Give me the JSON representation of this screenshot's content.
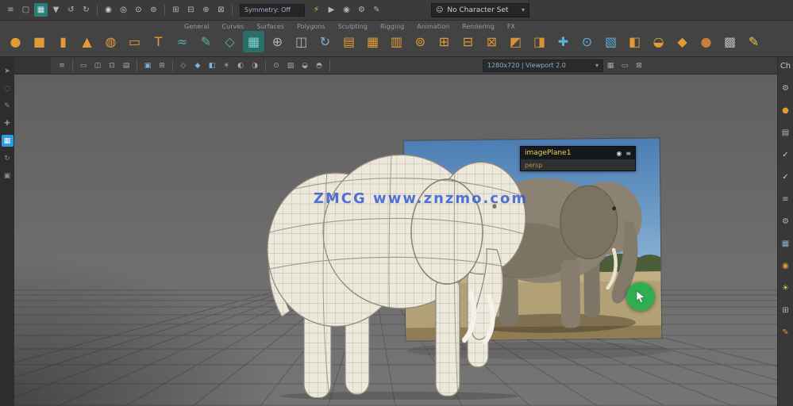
{
  "ui": {
    "caret": "▾"
  },
  "topbar": {
    "icons_left": [
      {
        "name": "menu-icon",
        "glyph": "≡",
        "color": "#b5b5b5"
      },
      {
        "name": "new-scene-icon",
        "glyph": "▢",
        "color": "#b5b5b5"
      },
      {
        "name": "open-scene-icon",
        "glyph": "▦",
        "color": "#cdeeea",
        "bg": "#2c7d78"
      },
      {
        "name": "save-scene-icon",
        "glyph": "▼",
        "color": "#b5b5b5"
      },
      {
        "name": "undo-icon",
        "glyph": "↺",
        "color": "#b5b5b5"
      },
      {
        "name": "redo-icon",
        "glyph": "↻",
        "color": "#b5b5b5"
      },
      {
        "sep": true,
        "name": "separator"
      },
      {
        "name": "select-hierarchy-icon",
        "glyph": "◉",
        "color": "#d0d0d0"
      },
      {
        "name": "select-object-icon",
        "glyph": "◎",
        "color": "#d0d0d0"
      },
      {
        "name": "select-component-icon",
        "glyph": "⊙",
        "color": "#d0d0d0"
      },
      {
        "name": "select-mask-icon",
        "glyph": "⊚",
        "color": "#9fc3e0"
      },
      {
        "sep": true,
        "name": "separator"
      },
      {
        "name": "snap-grid-icon",
        "glyph": "⊞",
        "color": "#b5b5b5"
      },
      {
        "name": "snap-curve-icon",
        "glyph": "⊟",
        "color": "#b5b5b5"
      },
      {
        "name": "snap-point-icon",
        "glyph": "⊕",
        "color": "#b5b5b5"
      },
      {
        "name": "snap-plane-icon",
        "glyph": "⊠",
        "color": "#b5b5b5"
      },
      {
        "sep": true,
        "name": "separator"
      }
    ],
    "selection_field": "Symmetry: Off",
    "icons_mid": [
      {
        "name": "construction-history-icon",
        "glyph": "⚡",
        "color": "#d8c44a"
      },
      {
        "name": "render-icon",
        "glyph": "▶",
        "color": "#b5b5b5"
      },
      {
        "name": "ipr-render-icon",
        "glyph": "◉",
        "color": "#b5b5b5"
      },
      {
        "name": "render-settings-icon",
        "glyph": "⚙",
        "color": "#b5b5b5"
      },
      {
        "name": "paint-effects-icon",
        "glyph": "✎",
        "color": "#b5b5b5"
      }
    ],
    "workspace": {
      "icon_glyph": "☺",
      "label": "No Character Set"
    }
  },
  "shelf": {
    "tabs": [
      {
        "name": "shelf-tab-general",
        "label": "General"
      },
      {
        "name": "shelf-tab-curves",
        "label": "Curves"
      },
      {
        "name": "shelf-tab-surfaces",
        "label": "Surfaces"
      },
      {
        "name": "shelf-tab-polygons",
        "label": "Polygons"
      },
      {
        "name": "shelf-tab-sculpting",
        "label": "Sculpting"
      },
      {
        "name": "shelf-tab-rigging",
        "label": "Rigging"
      },
      {
        "name": "shelf-tab-animation",
        "label": "Animation"
      },
      {
        "name": "shelf-tab-rendering",
        "label": "Rendering"
      },
      {
        "name": "shelf-tab-fx",
        "label": "FX"
      }
    ],
    "icons": [
      {
        "name": "sphere-primitive-icon",
        "glyph": "●",
        "color": "#e09b36"
      },
      {
        "name": "cube-primitive-icon",
        "glyph": "■",
        "color": "#e09b36"
      },
      {
        "name": "cylinder-primitive-icon",
        "glyph": "▮",
        "color": "#e09b36"
      },
      {
        "name": "cone-primitive-icon",
        "glyph": "▲",
        "color": "#e09b36"
      },
      {
        "name": "torus-primitive-icon",
        "glyph": "◍",
        "color": "#e09b36"
      },
      {
        "name": "plane-primitive-icon",
        "glyph": "▭",
        "color": "#e09b36"
      },
      {
        "name": "text-tool-icon",
        "glyph": "T",
        "color": "#e09b36"
      },
      {
        "name": "curve-tool-icon",
        "glyph": "≈",
        "color": "#4fb3aa"
      },
      {
        "name": "pencil-curve-icon",
        "glyph": "✎",
        "color": "#4fb3aa"
      },
      {
        "name": "ep-curve-icon",
        "glyph": "◇",
        "color": "#4fb3aa"
      },
      {
        "name": "panel-window-icon",
        "glyph": "▦",
        "color": "#7fd0ca",
        "bg": "#2c6f6a"
      },
      {
        "name": "magnet-icon",
        "glyph": "⊕",
        "color": "#b5b5b5"
      },
      {
        "name": "camera-icon",
        "glyph": "◫",
        "color": "#b5b5b5"
      },
      {
        "name": "orbit-icon",
        "glyph": "↻",
        "color": "#7fb2d9"
      },
      {
        "name": "graph-icon",
        "glyph": "▤",
        "color": "#e09b36"
      },
      {
        "name": "grid-icon",
        "glyph": "▦",
        "color": "#e09b36"
      },
      {
        "name": "columns-icon",
        "glyph": "▥",
        "color": "#e09b36"
      },
      {
        "name": "boolean-union-icon",
        "glyph": "⊚",
        "color": "#e09b36"
      },
      {
        "name": "combine-icon",
        "glyph": "⊞",
        "color": "#e09b36"
      },
      {
        "name": "separate-icon",
        "glyph": "⊟",
        "color": "#e09b36"
      },
      {
        "name": "extrude-icon",
        "glyph": "⊠",
        "color": "#d8923a"
      },
      {
        "name": "bevel-icon",
        "glyph": "◩",
        "color": "#d8923a"
      },
      {
        "name": "bridge-icon",
        "glyph": "◨",
        "color": "#d8923a"
      },
      {
        "name": "multi-cut-icon",
        "glyph": "✚",
        "color": "#5ab0d8"
      },
      {
        "name": "target-weld-icon",
        "glyph": "⊙",
        "color": "#5ab0d8"
      },
      {
        "name": "quad-draw-icon",
        "glyph": "▧",
        "color": "#5ab0d8"
      },
      {
        "name": "mirror-icon",
        "glyph": "◧",
        "color": "#e09b36"
      },
      {
        "name": "smooth-mesh-icon",
        "glyph": "◒",
        "color": "#e09b36"
      },
      {
        "name": "crease-icon",
        "glyph": "◆",
        "color": "#e09b36"
      },
      {
        "name": "sculpt-tool-icon",
        "glyph": "●",
        "color": "#c87f3a"
      },
      {
        "name": "lattice-icon",
        "glyph": "▩",
        "color": "#b5b5b5"
      },
      {
        "name": "paint-weights-icon",
        "glyph": "✎",
        "color": "#e3c84a"
      }
    ]
  },
  "panel_toolbar": {
    "icons": [
      {
        "name": "panel-menu-icon",
        "glyph": "≡"
      },
      {
        "sep": true,
        "name": "separator"
      },
      {
        "name": "camera-select-icon",
        "glyph": "▭"
      },
      {
        "name": "camera-lock-icon",
        "glyph": "◫"
      },
      {
        "name": "camera-attributes-icon",
        "glyph": "⊡"
      },
      {
        "name": "bookmark-icon",
        "glyph": "▤"
      },
      {
        "sep": true,
        "name": "separator"
      },
      {
        "name": "image-plane-icon",
        "glyph": "▣",
        "color": "#7fb2d9"
      },
      {
        "name": "pan-zoom-icon",
        "glyph": "⊞"
      },
      {
        "sep": true,
        "name": "separator"
      },
      {
        "name": "wireframe-mode-icon",
        "glyph": "◇"
      },
      {
        "name": "shaded-mode-icon",
        "glyph": "◆",
        "color": "#7fb2d9"
      },
      {
        "name": "textured-mode-icon",
        "glyph": "◧",
        "color": "#7fb2d9"
      },
      {
        "name": "use-lights-icon",
        "glyph": "☀"
      },
      {
        "name": "shadows-icon",
        "glyph": "◐"
      },
      {
        "name": "ambient-occlusion-icon",
        "glyph": "◑"
      },
      {
        "sep": true,
        "name": "separator"
      },
      {
        "name": "isolate-select-icon",
        "glyph": "⊙"
      },
      {
        "name": "xray-icon",
        "glyph": "▨"
      },
      {
        "name": "exposure-icon",
        "glyph": "◒"
      },
      {
        "name": "gamma-icon",
        "glyph": "◓"
      },
      {
        "sep": true,
        "name": "separator"
      }
    ],
    "dropdown_label": "1280x720 | Viewport 2.0",
    "icons_right": [
      {
        "name": "grid-toggle-icon",
        "glyph": "▦"
      },
      {
        "name": "film-gate-icon",
        "glyph": "▭"
      },
      {
        "name": "resolution-gate-icon",
        "glyph": "⊠"
      }
    ]
  },
  "toolbox": {
    "items": [
      {
        "name": "select-tool",
        "glyph": "➤"
      },
      {
        "name": "lasso-tool",
        "glyph": "◌"
      },
      {
        "name": "paint-select-tool",
        "glyph": "✎"
      },
      {
        "name": "move-tool",
        "glyph": "✚"
      },
      {
        "name": "single-pane-layout",
        "glyph": "▦",
        "active": true
      },
      {
        "name": "rotate-tool",
        "glyph": "↻"
      },
      {
        "name": "scale-tool",
        "glyph": "▣"
      }
    ]
  },
  "right_panel": {
    "icons": [
      {
        "name": "channel-box-tab",
        "label": "Ch",
        "color": "#c8c8c8"
      },
      {
        "name": "modeling-toolkit-icon",
        "glyph": "⚙",
        "color": "#b5b5b5"
      },
      {
        "name": "material-sphere-icon",
        "glyph": "●",
        "color": "#e09b36"
      },
      {
        "name": "outliner-icon",
        "glyph": "▤",
        "color": "#b5b5b5"
      },
      {
        "name": "visibility-check-icon",
        "glyph": "✓",
        "color": "#d0d0d0"
      },
      {
        "name": "playback-check-icon",
        "glyph": "✓",
        "color": "#d0d0d0"
      },
      {
        "name": "attribute-list-icon",
        "glyph": "≡",
        "color": "#b5b5b5"
      },
      {
        "name": "settings-gear-icon",
        "glyph": "⚙",
        "color": "#b5b5b5"
      },
      {
        "name": "texture-icon",
        "glyph": "▦",
        "color": "#7fb2d9"
      },
      {
        "name": "shader-ball-icon",
        "glyph": "◉",
        "color": "#e09b36"
      },
      {
        "name": "light-icon",
        "glyph": "☀",
        "color": "#e3c84a"
      },
      {
        "name": "uv-editor-icon",
        "glyph": "⊞",
        "color": "#b5b5b5"
      },
      {
        "name": "paint-tool-icon",
        "glyph": "✎",
        "color": "#e09b36"
      }
    ]
  },
  "viewport": {
    "watermark": "ZMCG  www.znzmo.com",
    "hud": {
      "title": "imagePlane1",
      "subtitle": "persp",
      "button1_glyph": "◉",
      "button2_glyph": "≡"
    }
  }
}
